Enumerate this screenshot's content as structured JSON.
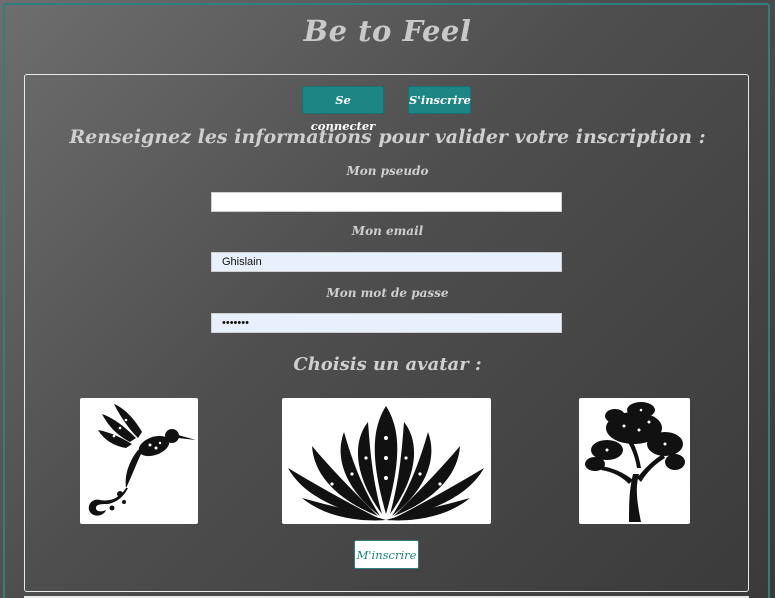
{
  "site": {
    "title": "Be to Feel"
  },
  "tabs": {
    "login_label": "Se connecter",
    "signup_label": "S'inscrire"
  },
  "form": {
    "heading": "Renseignez les informations pour valider votre inscription :",
    "pseudo": {
      "label": "Mon pseudo",
      "value": ""
    },
    "email": {
      "label": "Mon email",
      "value": "Ghislain"
    },
    "password": {
      "label": "Mon mot de passe",
      "value": "•••••••"
    }
  },
  "avatars": {
    "heading": "Choisis un avatar :",
    "items": [
      {
        "icon": "hummingbird-icon"
      },
      {
        "icon": "lotus-flower-icon"
      },
      {
        "icon": "tree-icon"
      }
    ]
  },
  "submit": {
    "label": "M'inscrire"
  },
  "colors": {
    "accent": "#1d8583",
    "border": "#2f7f7c",
    "text": "#cfcfcf"
  }
}
